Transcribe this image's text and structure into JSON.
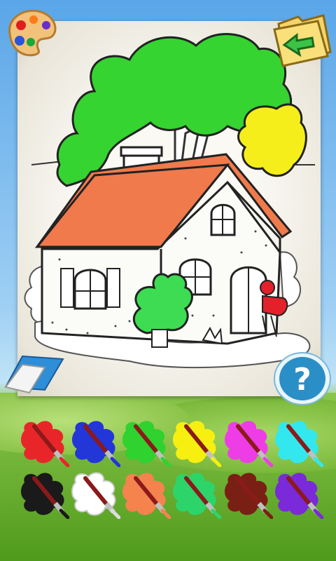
{
  "toolbar": {
    "palette_icon": "palette-icon",
    "back_icon": "folder-back-arrow-icon",
    "eraser_icon": "eraser-icon",
    "help_label": "?"
  },
  "drawing": {
    "subject": "house-with-tree-coloring-page",
    "colors": {
      "tree_green": "#35d431",
      "tree_yellow": "#f5ee1a",
      "roof": "#f07a4c",
      "bush": "#3ddc52",
      "girl_red": "#e3212a"
    }
  },
  "colors": [
    {
      "name": "red",
      "hex": "#e8262a"
    },
    {
      "name": "blue",
      "hex": "#2336d8"
    },
    {
      "name": "green",
      "hex": "#2fd22f"
    },
    {
      "name": "yellow",
      "hex": "#f6ef10"
    },
    {
      "name": "magenta",
      "hex": "#ee3de6"
    },
    {
      "name": "cyan",
      "hex": "#32e8ee"
    },
    {
      "name": "black",
      "hex": "#1a1a1a"
    },
    {
      "name": "white",
      "hex": "#ffffff"
    },
    {
      "name": "orange",
      "hex": "#f5834e"
    },
    {
      "name": "light-green",
      "hex": "#2dd46a"
    },
    {
      "name": "brown",
      "hex": "#7a1f14"
    },
    {
      "name": "purple",
      "hex": "#7a2ad8"
    }
  ]
}
